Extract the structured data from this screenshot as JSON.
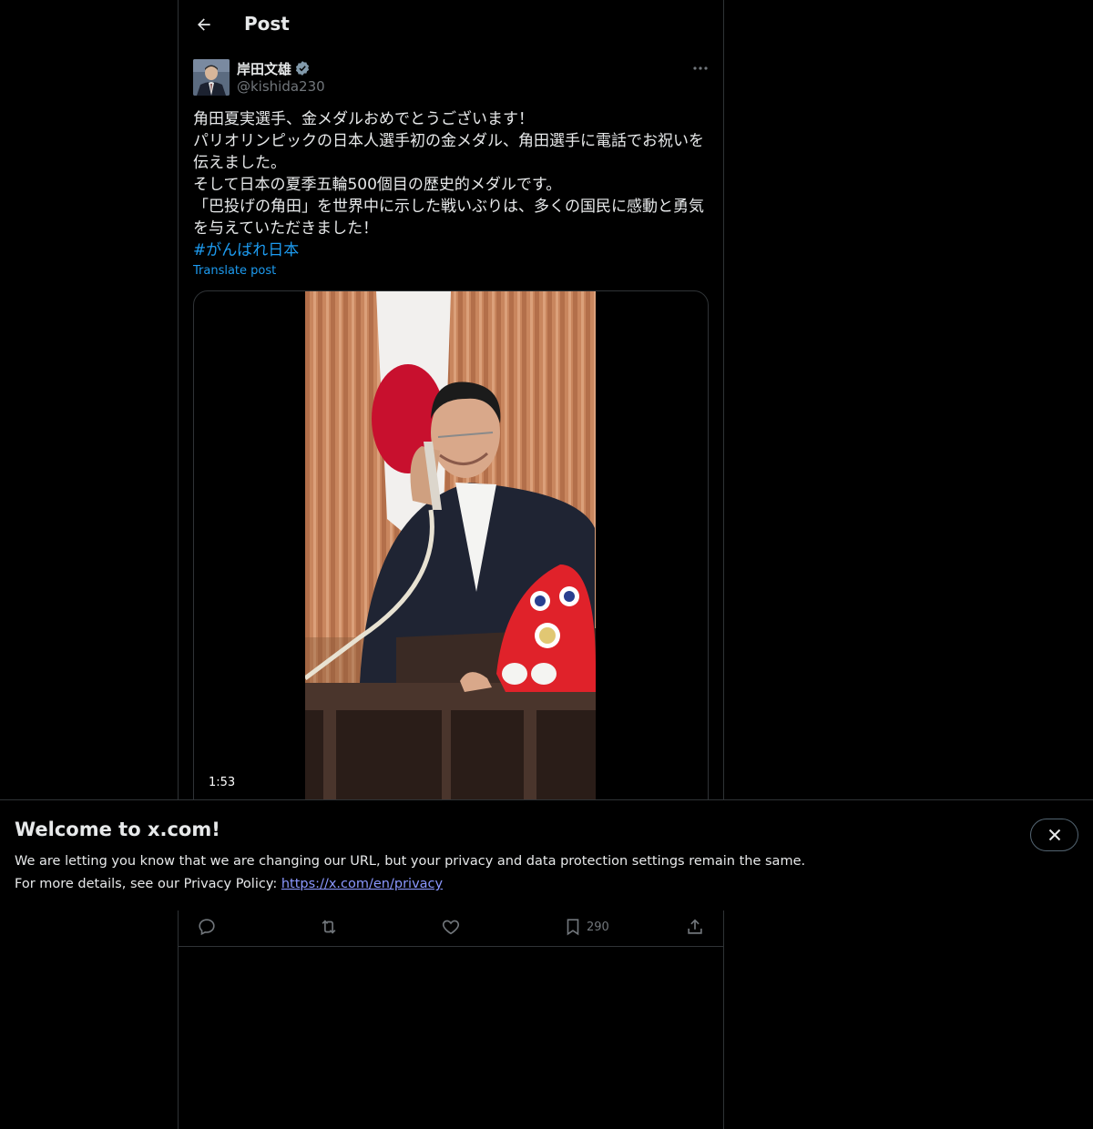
{
  "header": {
    "title": "Post"
  },
  "author": {
    "name": "岸田文雄",
    "handle": "@kishida230"
  },
  "tweet": {
    "lines": [
      "角田夏実選手、金メダルおめでとうございます！",
      "パリオリンピックの日本人選手初の金メダル、角田選手に電話でお祝いを",
      "伝えました。",
      "そして日本の夏季五輪500個目の歴史的メダルです。",
      "「巴投げの角田」を世界中に示した戦いぶりは、多くの国民に感動と勇気",
      "を与えていただきました！"
    ],
    "hashtag": "#がんばれ日本",
    "translate_label": "Translate post"
  },
  "media": {
    "duration": "1:53"
  },
  "actions": {
    "reply": {
      "icon": "reply-icon"
    },
    "repost": {
      "icon": "repost-icon"
    },
    "like": {
      "icon": "heart-icon"
    },
    "bookmark": {
      "icon": "bookmark-icon",
      "count": "290"
    },
    "share": {
      "icon": "share-icon"
    }
  },
  "banner": {
    "title": "Welcome to x.com!",
    "line1": "We are letting you know that we are changing our URL, but your privacy and data protection settings remain the same.",
    "line2_prefix": "For more details, see our Privacy Policy: ",
    "link": "https://x.com/en/privacy"
  },
  "colors": {
    "background": "#000000",
    "text": "#e7e9ea",
    "secondary_text": "#71767b",
    "accent": "#1d9bf0",
    "border": "#2f3336"
  }
}
